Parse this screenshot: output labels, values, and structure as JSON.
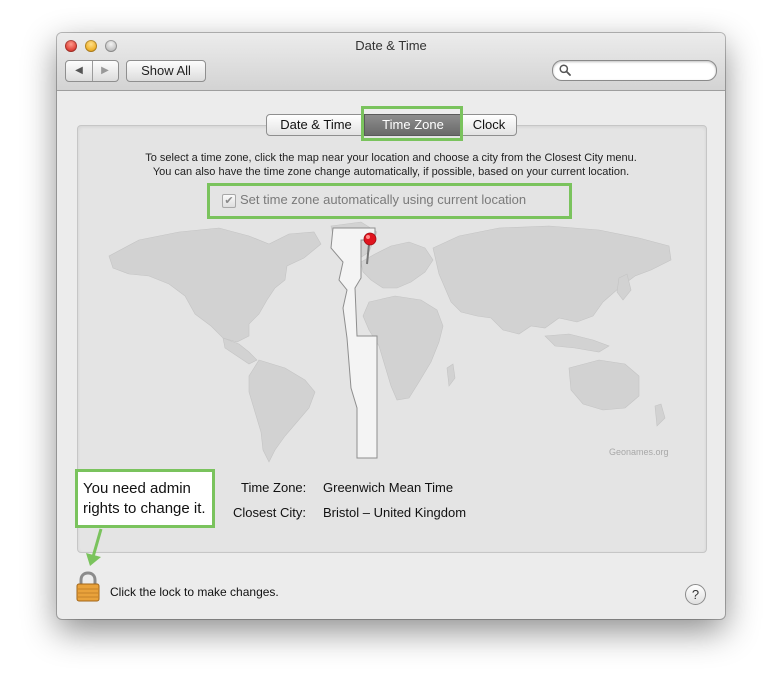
{
  "window": {
    "title": "Date & Time",
    "show_all_label": "Show All",
    "search_placeholder": ""
  },
  "tabs": [
    {
      "label": "Date & Time",
      "selected": false
    },
    {
      "label": "Time Zone",
      "selected": true
    },
    {
      "label": "Clock",
      "selected": false
    }
  ],
  "time_zone": {
    "instruction_line1": "To select a time zone, click the map near your location and choose a city from the Closest City menu.",
    "instruction_line2": "You can also have the time zone change automatically, if possible, based on your current location.",
    "auto_checkbox_label": "Set time zone automatically using current location",
    "auto_checkbox_checked": true,
    "map_credit": "Geonames.org",
    "time_zone_label": "Time Zone:",
    "time_zone_value": "Greenwich Mean Time",
    "closest_city_label": "Closest City:",
    "closest_city_value": "Bristol – United Kingdom"
  },
  "annotation": {
    "text": "You need admin rights to change it.",
    "color": "#7ac35d"
  },
  "footer": {
    "lock_text": "Click the lock to make changes.",
    "help_label": "?"
  },
  "colors": {
    "highlight": "#7ac35d",
    "selected_tab": "#7a7a7a",
    "pin": "#e0141e",
    "land": "#d2d2d2"
  }
}
